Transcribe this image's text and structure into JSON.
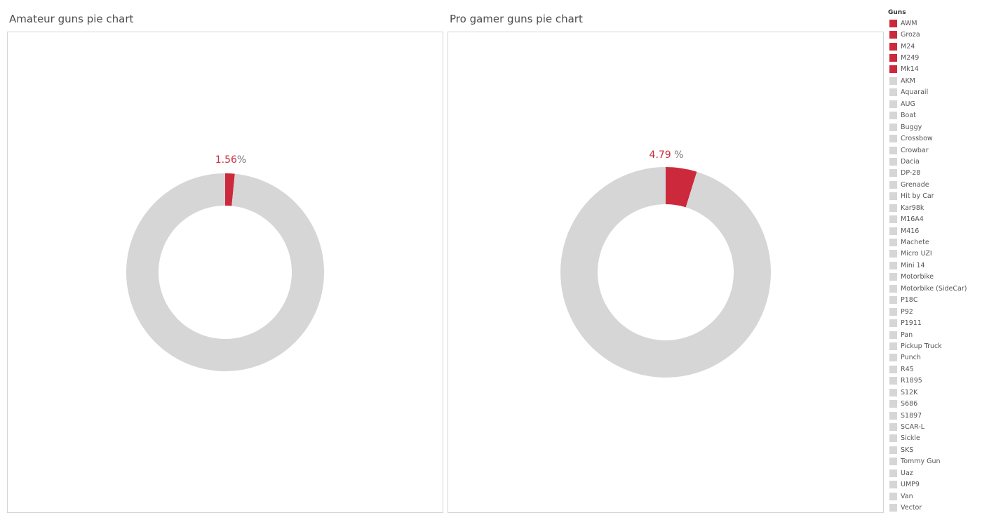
{
  "colors": {
    "highlight": "#cc2a3c",
    "other": "#d6d6d6",
    "percent_text": "#c9303e",
    "percent_symbol": "#777777"
  },
  "legend": {
    "title": "Guns",
    "highlighted": [
      "AWM",
      "Groza",
      "M24",
      "M249",
      "Mk14"
    ],
    "items": [
      "AWM",
      "Groza",
      "M24",
      "M249",
      "Mk14",
      "AKM",
      "Aquarail",
      "AUG",
      "Boat",
      "Buggy",
      "Crossbow",
      "Crowbar",
      "Dacia",
      "DP-28",
      "Grenade",
      "Hit by Car",
      "Kar98k",
      "M16A4",
      "M416",
      "Machete",
      "Micro UZI",
      "Mini 14",
      "Motorbike",
      "Motorbike (SideCar)",
      "P18C",
      "P92",
      "P1911",
      "Pan",
      "Pickup Truck",
      "Punch",
      "R45",
      "R1895",
      "S12K",
      "S686",
      "S1897",
      "SCAR-L",
      "Sickle",
      "SKS",
      "Tommy Gun",
      "Uaz",
      "UMP9",
      "Van",
      "Vector"
    ]
  },
  "chart_data": [
    {
      "type": "pie",
      "title": "Amateur guns pie chart",
      "donut": true,
      "slices": [
        {
          "label": "AWM, Groza, M24, M249, Mk14",
          "value": 1.56,
          "highlight": true
        },
        {
          "label": "Other guns",
          "value": 98.44,
          "highlight": false
        }
      ],
      "data_label": {
        "number": "1.56",
        "symbol": "%"
      }
    },
    {
      "type": "pie",
      "title": "Pro gamer guns pie chart",
      "donut": true,
      "slices": [
        {
          "label": "AWM, Groza, M24, M249, Mk14",
          "value": 4.79,
          "highlight": true
        },
        {
          "label": "Other guns",
          "value": 95.21,
          "highlight": false
        }
      ],
      "data_label": {
        "number": "4.79",
        "symbol": " %"
      }
    }
  ]
}
